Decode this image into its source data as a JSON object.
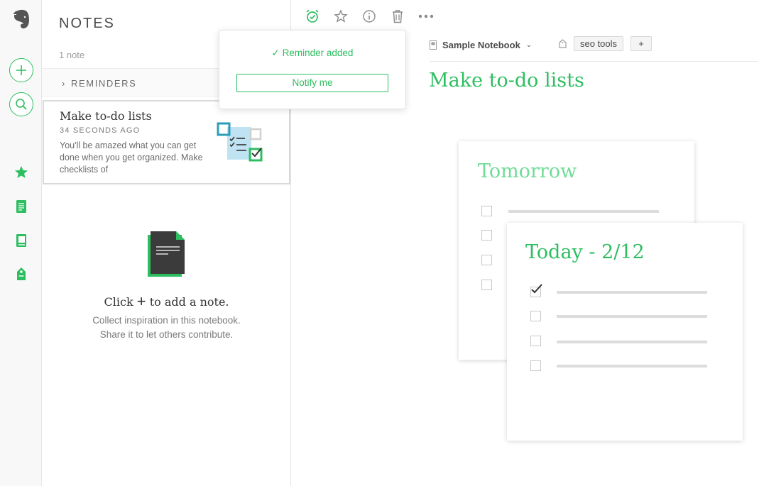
{
  "sidebar": {
    "icons": [
      "evernote-logo",
      "new-note-icon",
      "search-icon",
      "shortcuts-star-icon",
      "notes-icon",
      "notebooks-icon",
      "tags-icon"
    ]
  },
  "note_list": {
    "title": "NOTES",
    "count": "1 note",
    "reminders_label": "REMINDERS",
    "note": {
      "title": "Make to-do lists",
      "time": "34 SECONDS AGO",
      "snippet": "You'll be amazed what you can get done when you get organized. Make checklists of"
    },
    "empty": {
      "line1_pre": "Click",
      "plus": "+",
      "line1_post": "to add a note.",
      "line2": "Collect inspiration in this notebook.",
      "line3": "Share it to let others contribute."
    }
  },
  "toolbar": {
    "icons": [
      "reminder-alarm-icon",
      "star-icon",
      "info-icon",
      "trash-icon",
      "more-icon"
    ]
  },
  "reminder_popover": {
    "check": "✓",
    "message": "Reminder added",
    "button": "Notify me"
  },
  "note": {
    "notebook": "Sample Notebook",
    "tag": "seo tools",
    "add_tag": "+",
    "title": "Make to-do lists",
    "illustration": {
      "back_title": "Tomorrow",
      "front_title": "Today - 2/12"
    }
  },
  "colors": {
    "accent": "#2dbe60",
    "border": "#e6e6e6",
    "text": "#4a4a4a"
  }
}
